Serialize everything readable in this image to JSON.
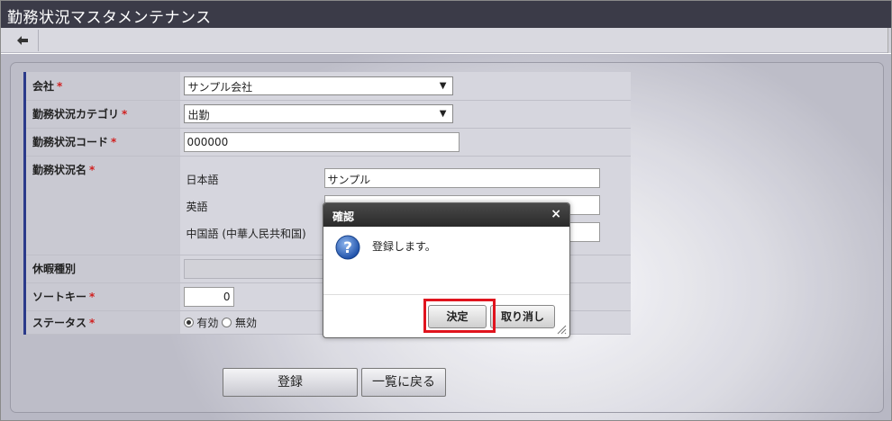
{
  "window": {
    "title": "勤務状況マスタメンテナンス"
  },
  "form": {
    "company": {
      "label": "会社",
      "value": "サンプル会社"
    },
    "category": {
      "label": "勤務状況カテゴリ",
      "value": "出勤"
    },
    "code": {
      "label": "勤務状況コード",
      "value": "000000"
    },
    "name": {
      "label": "勤務状況名",
      "langs": [
        {
          "lang": "日本語",
          "value": "サンプル"
        },
        {
          "lang": "英語",
          "value": ""
        },
        {
          "lang": "中国語 (中華人民共和国)",
          "value": ""
        }
      ]
    },
    "leave_type": {
      "label": "休暇種別",
      "value": ""
    },
    "sort_key": {
      "label": "ソートキー",
      "value": "0"
    },
    "status": {
      "label": "ステータス",
      "options": [
        "有効",
        "無効"
      ],
      "selected": "有効"
    },
    "required_mark": "*"
  },
  "actions": {
    "register": "登録",
    "back_to_list": "一覧に戻る"
  },
  "dialog": {
    "title": "確認",
    "message": "登録します。",
    "ok": "決定",
    "cancel": "取り消し",
    "close": "×"
  }
}
